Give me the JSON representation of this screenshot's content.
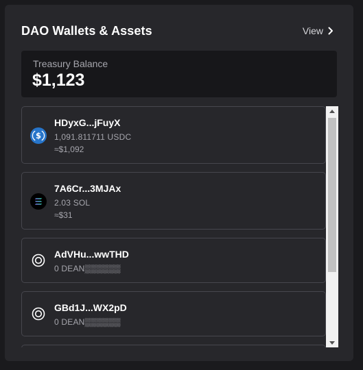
{
  "header": {
    "title": "DAO Wallets & Assets",
    "view_label": "View"
  },
  "balance": {
    "label": "Treasury Balance",
    "value": "$1,123"
  },
  "wallets": [
    {
      "address": "HDyxG...jFuyX",
      "amount": "1,091.811711 USDC",
      "usd": "≈$1,092",
      "icon": "usdc-icon"
    },
    {
      "address": "7A6Cr...3MJAx",
      "amount": "2.03 SOL",
      "usd": "≈$31",
      "icon": "solana-icon"
    },
    {
      "address": "AdVHu...wwTHD",
      "amount": "0 DEAN▒▒▒▒▒▒",
      "icon": "token-ring-icon"
    },
    {
      "address": "GBd1J...WX2pD",
      "amount": "0 DEAN▒▒▒▒▒▒",
      "icon": "token-ring-icon"
    }
  ],
  "colors": {
    "usdc": "#2775ca",
    "panel": "#27272b",
    "card": "#17171a",
    "border": "#47474e"
  }
}
